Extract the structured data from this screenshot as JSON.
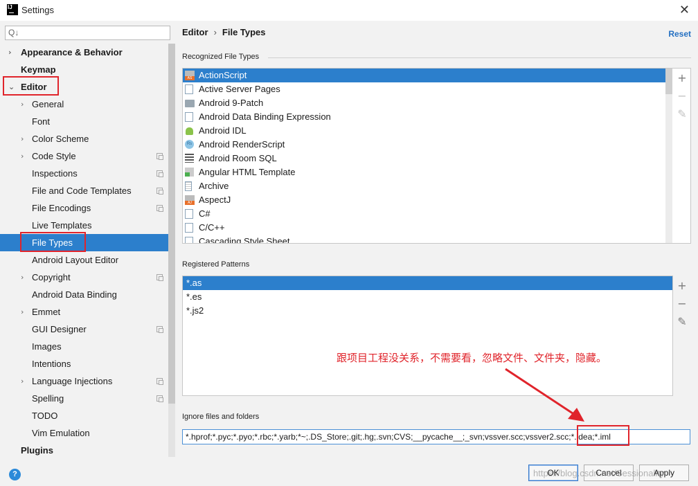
{
  "window": {
    "title": "Settings",
    "app_icon_text": "IJ"
  },
  "search": {
    "placeholder": "Q↓"
  },
  "tree": [
    {
      "label": "Appearance & Behavior",
      "bold": true,
      "arrow": "›",
      "indent": 0
    },
    {
      "label": "Keymap",
      "bold": true,
      "arrow": "",
      "indent": 0
    },
    {
      "label": "Editor",
      "bold": true,
      "arrow": "⌄",
      "indent": 0
    },
    {
      "label": "General",
      "arrow": "›",
      "indent": 1
    },
    {
      "label": "Font",
      "arrow": "",
      "indent": 1
    },
    {
      "label": "Color Scheme",
      "arrow": "›",
      "indent": 1
    },
    {
      "label": "Code Style",
      "arrow": "›",
      "indent": 1,
      "copy": true
    },
    {
      "label": "Inspections",
      "arrow": "",
      "indent": 1,
      "copy": true
    },
    {
      "label": "File and Code Templates",
      "arrow": "",
      "indent": 1,
      "copy": true
    },
    {
      "label": "File Encodings",
      "arrow": "",
      "indent": 1,
      "copy": true
    },
    {
      "label": "Live Templates",
      "arrow": "",
      "indent": 1
    },
    {
      "label": "File Types",
      "arrow": "",
      "indent": 1,
      "selected": true
    },
    {
      "label": "Android Layout Editor",
      "arrow": "",
      "indent": 1
    },
    {
      "label": "Copyright",
      "arrow": "›",
      "indent": 1,
      "copy": true
    },
    {
      "label": "Android Data Binding",
      "arrow": "",
      "indent": 1
    },
    {
      "label": "Emmet",
      "arrow": "›",
      "indent": 1
    },
    {
      "label": "GUI Designer",
      "arrow": "",
      "indent": 1,
      "copy": true
    },
    {
      "label": "Images",
      "arrow": "",
      "indent": 1
    },
    {
      "label": "Intentions",
      "arrow": "",
      "indent": 1
    },
    {
      "label": "Language Injections",
      "arrow": "›",
      "indent": 1,
      "copy": true
    },
    {
      "label": "Spelling",
      "arrow": "",
      "indent": 1,
      "copy": true
    },
    {
      "label": "TODO",
      "arrow": "",
      "indent": 1
    },
    {
      "label": "Vim Emulation",
      "arrow": "",
      "indent": 1
    },
    {
      "label": "Plugins",
      "bold": true,
      "arrow": "",
      "indent": 0
    }
  ],
  "breadcrumb": {
    "parent": "Editor",
    "separator": "›",
    "current": "File Types"
  },
  "reset_label": "Reset",
  "recognized": {
    "title": "Recognized File Types",
    "items": [
      {
        "label": "ActionScript",
        "icon": "actionscript-icon",
        "selected": true
      },
      {
        "label": "Active Server Pages",
        "icon": "asp-icon"
      },
      {
        "label": "Android 9-Patch",
        "icon": "folder-icon"
      },
      {
        "label": "Android Data Binding Expression",
        "icon": "data-binding-icon"
      },
      {
        "label": "Android IDL",
        "icon": "android-icon"
      },
      {
        "label": "Android RenderScript",
        "icon": "renderscript-icon"
      },
      {
        "label": "Android Room SQL",
        "icon": "sql-icon"
      },
      {
        "label": "Angular HTML Template",
        "icon": "html-icon"
      },
      {
        "label": "Archive",
        "icon": "archive-icon"
      },
      {
        "label": "AspectJ",
        "icon": "aspectj-icon"
      },
      {
        "label": "C#",
        "icon": "csharp-icon"
      },
      {
        "label": "C/C++",
        "icon": "cpp-icon"
      },
      {
        "label": "Cascading Style Sheet",
        "icon": "css-icon"
      }
    ]
  },
  "patterns": {
    "title": "Registered Patterns",
    "items": [
      {
        "label": "*.as",
        "selected": true
      },
      {
        "label": "*.es"
      },
      {
        "label": "*.js2"
      }
    ]
  },
  "annotation": "跟项目工程没关系，不需要看，忽略文件、文件夹，隐藏。",
  "ignore": {
    "title": "Ignore files and folders",
    "value": "*.hprof;*.pyc;*.pyo;*.rbc;*.yarb;*~;.DS_Store;.git;.hg;.svn;CVS;__pycache__;_svn;vssver.scc;vssver2.scc;*.idea;*.iml"
  },
  "buttons": {
    "ok": "OK",
    "cancel": "Cancel",
    "apply": "Apply"
  },
  "help_label": "?",
  "watermark": "https://blog.csdn.net/Sessionality",
  "colors": {
    "selection": "#2c7fcc",
    "accent_link": "#2470c2",
    "highlight": "#e0242b"
  }
}
